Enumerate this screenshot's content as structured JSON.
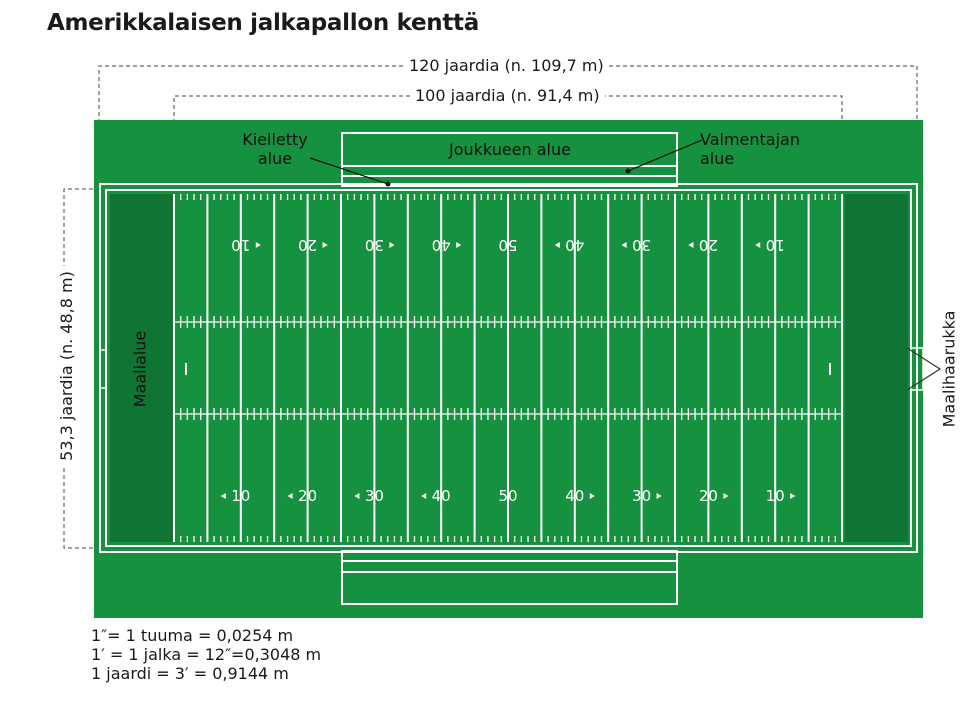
{
  "title": "Amerikkalaisen jalkapallon kenttä",
  "dimensions": {
    "total_length": "120 jaardia (n. 109,7 m)",
    "field_length": "100 jaardia (n. 91,4 m)",
    "width": "53,3 jaardia (n. 48,8 m)"
  },
  "labels": {
    "restricted_area_line1": "Kielletty",
    "restricted_area_line2": "alue",
    "team_area": "Joukkueen alue",
    "coach_area_line1": "Valmentajan",
    "coach_area_line2": "alue",
    "end_zone": "Maalialue",
    "goal_post": "Maalihaarukka"
  },
  "yard_numbers": [
    "10",
    "20",
    "30",
    "40",
    "50",
    "40",
    "30",
    "20",
    "10"
  ],
  "units": [
    "1″= 1 tuuma = 0,0254 m",
    "1′ = 1 jalka = 12″=0,3048 m",
    "1 jaardi = 3′ = 0,9144 m"
  ],
  "colors": {
    "field_green": "#16913f",
    "end_zone_green": "#0f7434",
    "line_white": "#ffffff",
    "text": "#1a1a1a"
  }
}
